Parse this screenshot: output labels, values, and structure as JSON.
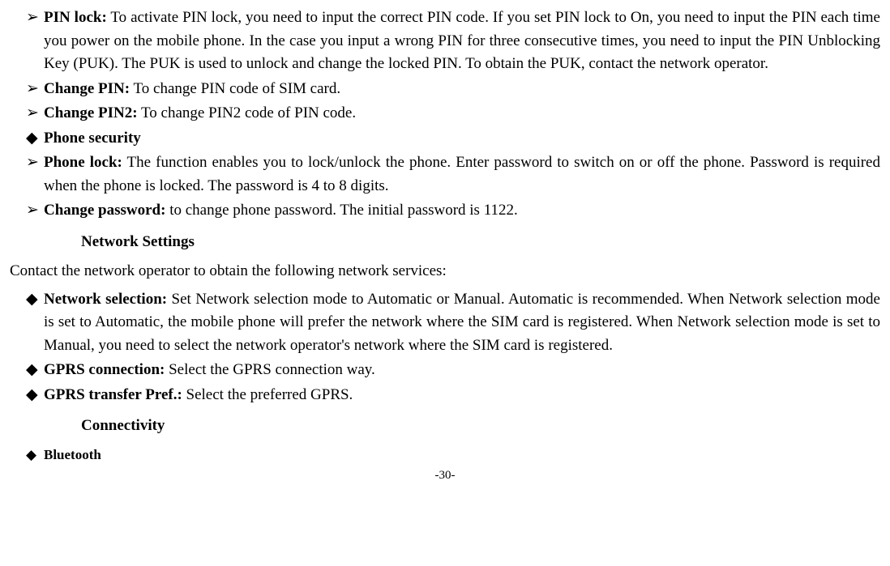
{
  "items": {
    "pin_lock_label": "PIN lock:",
    "pin_lock_text": " To activate PIN lock, you need to input the correct PIN code. If you set PIN lock to On, you need to input the PIN each time you power on the mobile phone. In the case you input a wrong PIN for three consecutive times, you need to input the PIN Unblocking Key (PUK). The PUK is used to unlock and change the locked PIN. To obtain the PUK, contact the network operator.",
    "change_pin_label": "Change PIN:",
    "change_pin_text": " To change PIN code of SIM card.",
    "change_pin2_label": "Change PIN2:",
    "change_pin2_text": " To change PIN2 code of PIN code.",
    "phone_security_label": "Phone security",
    "phone_lock_label": "Phone lock:",
    "phone_lock_text": " The function enables you to lock/unlock the phone. Enter password to switch on or off the phone. Password is required when the phone is locked. The password is 4 to 8 digits.",
    "change_password_label": "Change password:",
    "change_password_text": " to change phone password. The initial password is 1122.",
    "network_settings_heading": "Network Settings",
    "network_intro": "Contact the network operator to obtain the following network services:",
    "network_selection_label": "Network selection:",
    "network_selection_text": " Set Network selection mode to Automatic or Manual. Automatic is recommended. When Network selection mode is set to Automatic, the mobile phone will prefer the network where the SIM card is registered. When Network selection mode is set to Manual, you need to select the network operator's network where the SIM card is registered.",
    "gprs_connection_label": "GPRS connection:",
    "gprs_connection_text": " Select the GPRS connection way.",
    "gprs_transfer_label": "GPRS transfer Pref.:",
    "gprs_transfer_text": " Select the preferred GPRS.",
    "connectivity_heading": "Connectivity",
    "bluetooth_label": "Bluetooth"
  },
  "bullets": {
    "arrow": "➢",
    "diamond": "◆"
  },
  "page_number": "-30-"
}
